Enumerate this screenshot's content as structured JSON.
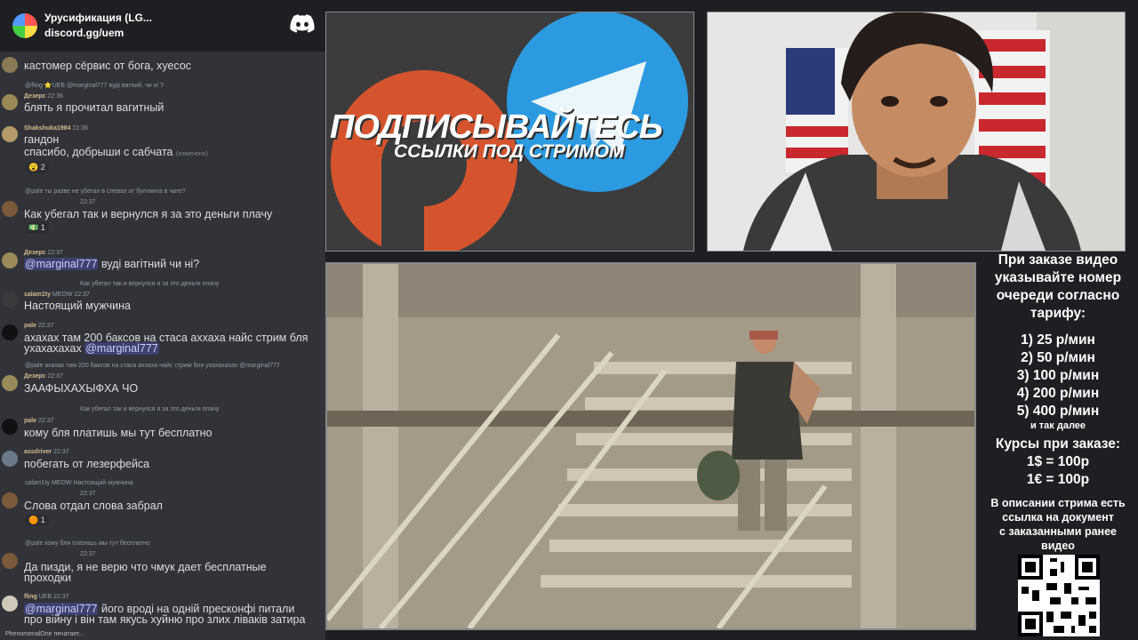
{
  "header": {
    "server_name": "Урусификация (LG...",
    "invite": "discord.gg/uem"
  },
  "chat": [
    {
      "text": "кастомер сёрвис от бога, хуесос"
    },
    {
      "reply": "@fling ⭐UEB @marginal777 вуді ватний, чи ні ?",
      "user": "Дезерс",
      "time": "22:36",
      "text": "блять я прочитал вагитный"
    },
    {
      "user": "Shakshuka1984",
      "time": "22:36",
      "text": "гандон",
      "text2": "спасибо, добрыши с сабчата",
      "edited": "(изменено)",
      "reaction": "😮 2"
    },
    {
      "reply": "@pale ты разве не убегал в слевах от буллинга в чате?",
      "time": "22:37",
      "text": "Как убегал так и вернулся я за это деньги плачу",
      "reaction": "💵 1"
    },
    {
      "user": "Дезерс",
      "time": "22:37",
      "mention": "@marginal777",
      "text": " вуді вагітний чи ні?"
    },
    {
      "reply": "Как убегал так и вернулся я за это деньги плачу",
      "user": "salam1ty",
      "badge": "MEOW",
      "time": "22:37",
      "text": "Настоящий мужчина"
    },
    {
      "user": "pale",
      "time": "22:37",
      "text": "ахахах там 200 баксов на стаса аххаха найс стрим бля",
      "text2": "ухахахахах ",
      "mention2": "@marginal777"
    },
    {
      "reply": "@pale ахахах там 200 баксов на стаса аххаха найс стрим бля ухахахахах @marginal777",
      "user": "Дезерс",
      "time": "22:37",
      "text": "ЗААФЫХАХЫФХА ЧО"
    },
    {
      "reply": "Как убегал так и вернулся я за это деньги плачу",
      "user": "pale",
      "time": "22:37",
      "text": "кому бля платишь мы тут бесплатно"
    },
    {
      "user": "assdriver",
      "time": "22:37",
      "text": "побегать от лезерфейса"
    },
    {
      "reply": "salam1ty MEOW Настоящий мужчина",
      "time": "22:37",
      "text": "Слова отдал слова забрал",
      "reaction": "🟠 1"
    },
    {
      "reply": "@pale кому бля платишь мы тут бесплатно",
      "time": "22:37",
      "text": "Да пизди, я не верю что чмук дает бесплатные",
      "text2": "проходки"
    },
    {
      "user": "fling",
      "badge": "UEB",
      "time": "22:37",
      "mention": "@marginal777",
      "text": " його вроді на одній пресконфі питали",
      "text2": "про війну і він там якусь хуйню про злих ліваків затира"
    }
  ],
  "typing": "PhenomenalOne печатает...",
  "promo": {
    "title": "ПОДПИСЫВАЙТЕСЬ",
    "subtitle": "ССЫЛКИ ПОД СТРИМОМ"
  },
  "side": {
    "heading": [
      "При заказе видео",
      "указывайте номер",
      "очереди согласно",
      "тарифу:"
    ],
    "tariffs": [
      "1) 25 р/мин",
      "2) 50 р/мин",
      "3) 100 р/мин",
      "4) 200 р/мин",
      "5) 400 р/мин"
    ],
    "tariff_more": "и так далее",
    "courses_title": "Курсы при заказе:",
    "courses": [
      "1$ = 100р",
      "1€ = 100р"
    ],
    "desc": [
      "В описании стрима есть",
      "ссылка на документ",
      "с заказанными ранее",
      "видео"
    ]
  },
  "colors": {
    "chat_bg": "#313338",
    "header_bg": "#1e1f22",
    "mention": "#c9cdfb",
    "telegram": "#2b9ae0",
    "patreon": "#d5542e"
  }
}
